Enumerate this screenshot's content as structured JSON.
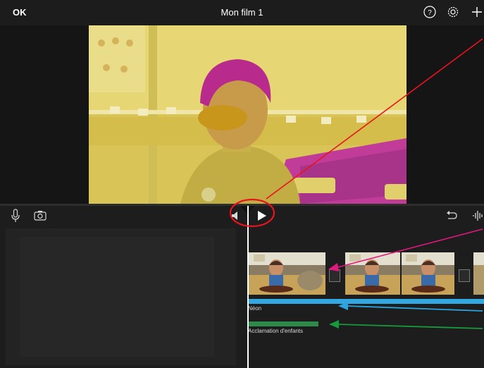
{
  "topbar": {
    "done_label": "OK",
    "project_title": "Mon film 1",
    "icons": [
      "help-icon",
      "settings-icon",
      "add-icon"
    ]
  },
  "toolbar": {
    "icons": [
      "microphone-icon",
      "camera-icon",
      "volume-icon",
      "play-icon",
      "undo-icon",
      "audio-waveform-icon"
    ]
  },
  "timeline": {
    "audio_track_1_label": "Néon",
    "audio_track_2_label": "Acclamation d'enfants"
  },
  "annotations": {
    "arrow_colors": {
      "red": "#e8141e",
      "magenta": "#e2187e",
      "blue": "#2aa4df",
      "green": "#179a3c"
    }
  },
  "colors": {
    "app_background": "#1d1d1d",
    "theme_track": "#33a8e0",
    "sound_effect_track": "#2e8a4a",
    "playhead": "#ffffff"
  }
}
